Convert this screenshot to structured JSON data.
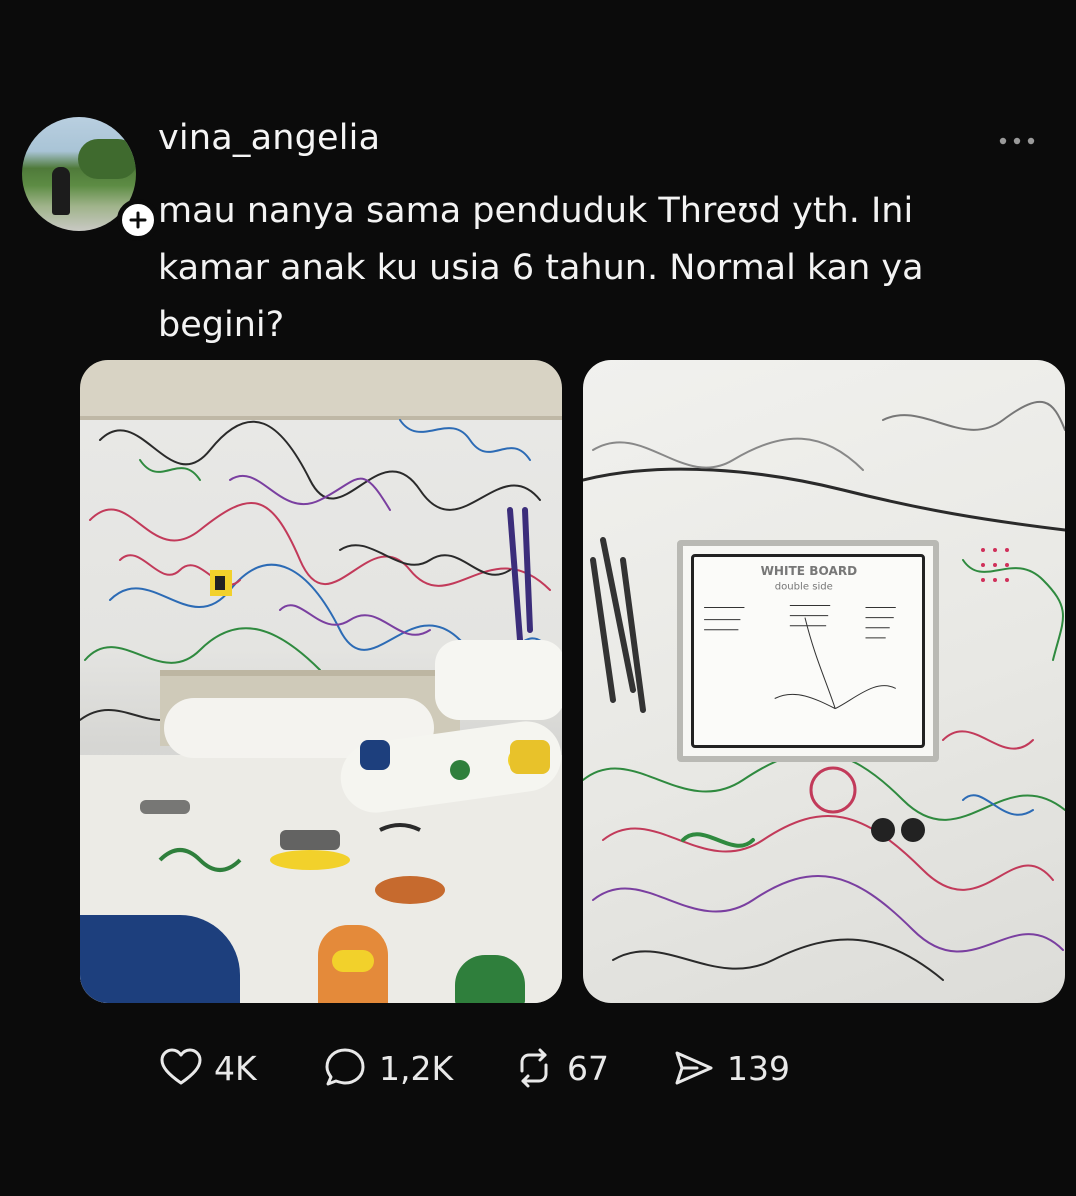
{
  "post": {
    "username": "vina_angelia",
    "text_lines": [
      "mau nanya sama penduduk Threʊd yth. Ini",
      "kamar anak ku usia 6 tahun. Normal kan ya",
      "begini?"
    ],
    "images": [
      {
        "alt": "photo-bedroom-wall-drawings"
      },
      {
        "alt": "photo-whiteboard-wall-drawings"
      }
    ],
    "whiteboard_text": [
      "WHITE BOARD",
      "double side"
    ],
    "actions": {
      "like_count": "4K",
      "reply_count": "1,2K",
      "repost_count": "67",
      "share_count": "139"
    }
  },
  "icons": {
    "like": "heart-icon",
    "reply": "speech-bubble-icon",
    "repost": "repost-arrows-icon",
    "share": "send-icon",
    "more": "more-options-icon",
    "follow": "plus-icon"
  },
  "colors": {
    "background": "#0b0b0b",
    "text": "#f3f3f3"
  }
}
